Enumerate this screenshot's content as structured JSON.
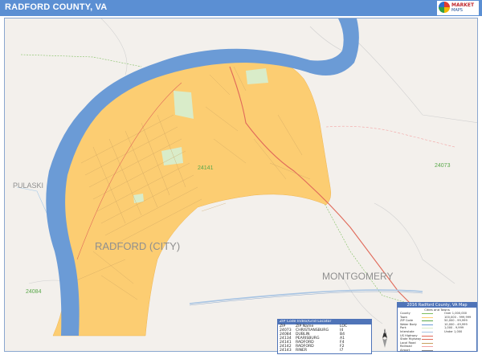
{
  "header": {
    "title": "RADFORD COUNTY, VA"
  },
  "colors": {
    "header": "#5b8fd3",
    "river": "#6b9bd6",
    "city": "#fccd72",
    "background": "#f3f0ec",
    "parks": "#d9ecc9"
  },
  "map": {
    "place_labels": [
      "PULASKI",
      "RADFORD (CITY)",
      "MONTGOMERY"
    ],
    "zip_labels": [
      "24141",
      "24073",
      "24084"
    ],
    "icons": [
      "compass-icon",
      "publisher-logo-icon"
    ]
  },
  "zip_table": {
    "title": "ZIP Code Index/Grid Locator",
    "columns": [
      "ZIP",
      "ZIP Name",
      "LOC"
    ],
    "rows": [
      [
        "24073",
        "CHRISTIANSBURG",
        "I4"
      ],
      [
        "24084",
        "DUBLIN",
        "B4"
      ],
      [
        "24134",
        "PEARISBURG",
        "A1"
      ],
      [
        "24141",
        "RADFORD",
        "F4"
      ],
      [
        "24142",
        "RADFORD",
        "F2"
      ],
      [
        "24143",
        "RINER",
        "I7"
      ]
    ]
  },
  "legend": {
    "title": "2016 Radford County, VA Map",
    "subtitle": "Cities and Towns",
    "rows": [
      "County",
      "Town",
      "ZIP Code",
      "Water Body",
      "Park",
      "Interstate",
      "US Highway",
      "State Highway",
      "Local Road",
      "Railroad",
      "Airport",
      "Hospital"
    ],
    "right_rows": [
      "Over 1,000,000",
      "100,000 - 999,999",
      "50,000 - 99,999",
      "10,000 - 49,999",
      "1,000 - 9,999",
      "Under 1,000"
    ]
  }
}
